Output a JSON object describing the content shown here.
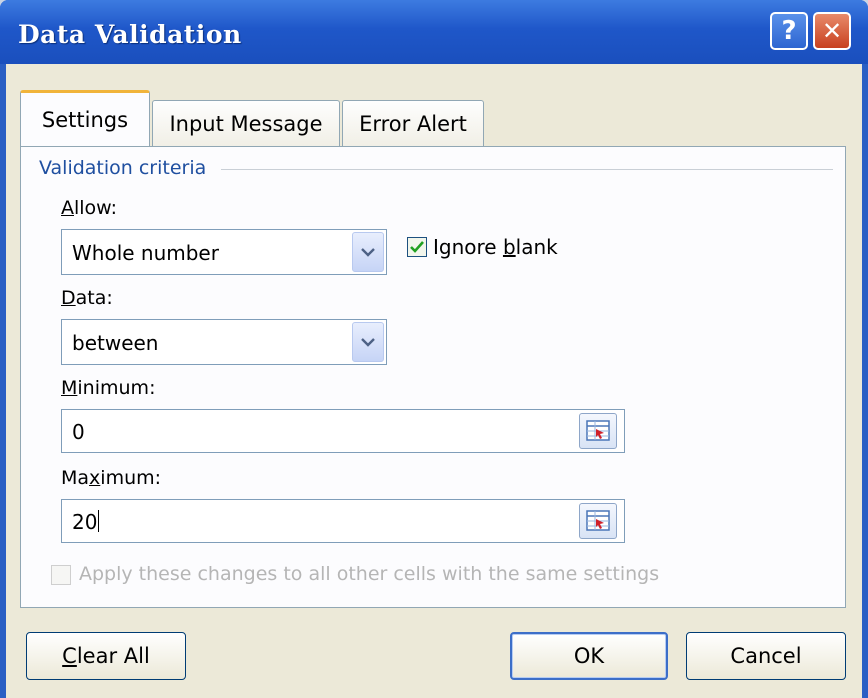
{
  "window": {
    "title": "Data Validation",
    "help_glyph": "?",
    "close_glyph": "✕"
  },
  "tabs": [
    {
      "label": "Settings",
      "active": true
    },
    {
      "label": "Input Message",
      "active": false
    },
    {
      "label": "Error Alert",
      "active": false
    }
  ],
  "settings": {
    "group_label": "Validation criteria",
    "allow": {
      "label_mnemonic": "A",
      "label_rest": "llow:",
      "value": "Whole number"
    },
    "ignore_blank": {
      "label_pre": "Ignore ",
      "label_mnemonic": "b",
      "label_post": "lank",
      "checked": true
    },
    "data": {
      "label_mnemonic": "D",
      "label_rest": "ata:",
      "value": "between"
    },
    "minimum": {
      "label_mnemonic": "M",
      "label_rest": "inimum:",
      "value": "0"
    },
    "maximum": {
      "label_pre": "Ma",
      "label_mnemonic": "x",
      "label_post": "imum:",
      "value": "20"
    },
    "apply_all": {
      "label": "Apply these changes to all other cells with the same settings",
      "checked": false,
      "enabled": false
    }
  },
  "buttons": {
    "clear_all": {
      "label_mnemonic": "C",
      "label_rest": "lear All"
    },
    "ok": "OK",
    "cancel": "Cancel"
  },
  "colors": {
    "titlebar": "#1f57c9",
    "accent_tab": "#f1b43a",
    "group_label": "#1f4fa0",
    "dialog_bg": "#ece9d8"
  },
  "icons": {
    "dropdown": "chevron-down-icon",
    "range_selector": "collapse-dialog-icon",
    "checkmark": "checkmark-icon"
  }
}
